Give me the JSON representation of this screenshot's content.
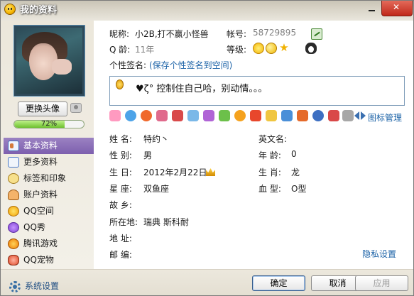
{
  "window": {
    "title": "我的资料"
  },
  "sidebar": {
    "avatar_caption": "",
    "change_avatar_label": "更换头像",
    "progress": {
      "percent": 72,
      "label": "72%"
    },
    "items": [
      {
        "label": "基本资料",
        "icon": "id-card-icon",
        "active": true
      },
      {
        "label": "更多资料",
        "icon": "more-info-icon",
        "active": false
      },
      {
        "label": "标签和印象",
        "icon": "tag-icon",
        "active": false
      },
      {
        "label": "账户资料",
        "icon": "account-icon",
        "active": false
      },
      {
        "label": "QQ空间",
        "icon": "qzone-icon",
        "active": false
      },
      {
        "label": "QQ秀",
        "icon": "qqshow-icon",
        "active": false
      },
      {
        "label": "腾讯游戏",
        "icon": "game-icon",
        "active": false
      },
      {
        "label": "QQ宠物",
        "icon": "pet-icon",
        "active": false
      }
    ],
    "settings_label": "系统设置"
  },
  "profile": {
    "nickname_label": "昵称:",
    "nickname": "小2B,打不赢小怪兽",
    "account_label": "帐号:",
    "account": "58729895",
    "qage_label": "Q 龄:",
    "qage": "11年",
    "level_label": "等级:",
    "signature_label": "个性签名:",
    "signature_link": "(保存个性签名到空间)",
    "signature_text": "♥ζ°  控制住自己哈，别动情。。。",
    "icon_manage_label": "图标管理",
    "fields_left": [
      {
        "label": "姓    名:",
        "value": "特约丶"
      },
      {
        "label": "性    别:",
        "value": "男"
      },
      {
        "label": "生    日:",
        "value": "2012年2月22日"
      },
      {
        "label": "星    座:",
        "value": "双鱼座"
      },
      {
        "label": "故    乡:",
        "value": ""
      },
      {
        "label": "所在地:",
        "value": "瑞典  斯科耐"
      },
      {
        "label": "地    址:",
        "value": ""
      },
      {
        "label": "邮    编:",
        "value": ""
      }
    ],
    "fields_right": [
      {
        "label": "英文名:",
        "value": ""
      },
      {
        "label": "年    龄:",
        "value": "0"
      },
      {
        "label": "生    肖:",
        "value": "龙"
      },
      {
        "label": "血    型:",
        "value": "O型"
      }
    ],
    "privacy_label": "隐私设置"
  },
  "footer": {
    "ok_label": "确定",
    "cancel_label": "取消",
    "apply_label": "应用"
  },
  "colors": {
    "accent_purple": "#8a6db9",
    "link_blue": "#1e64a8",
    "progress_green": "#6dc12e"
  }
}
